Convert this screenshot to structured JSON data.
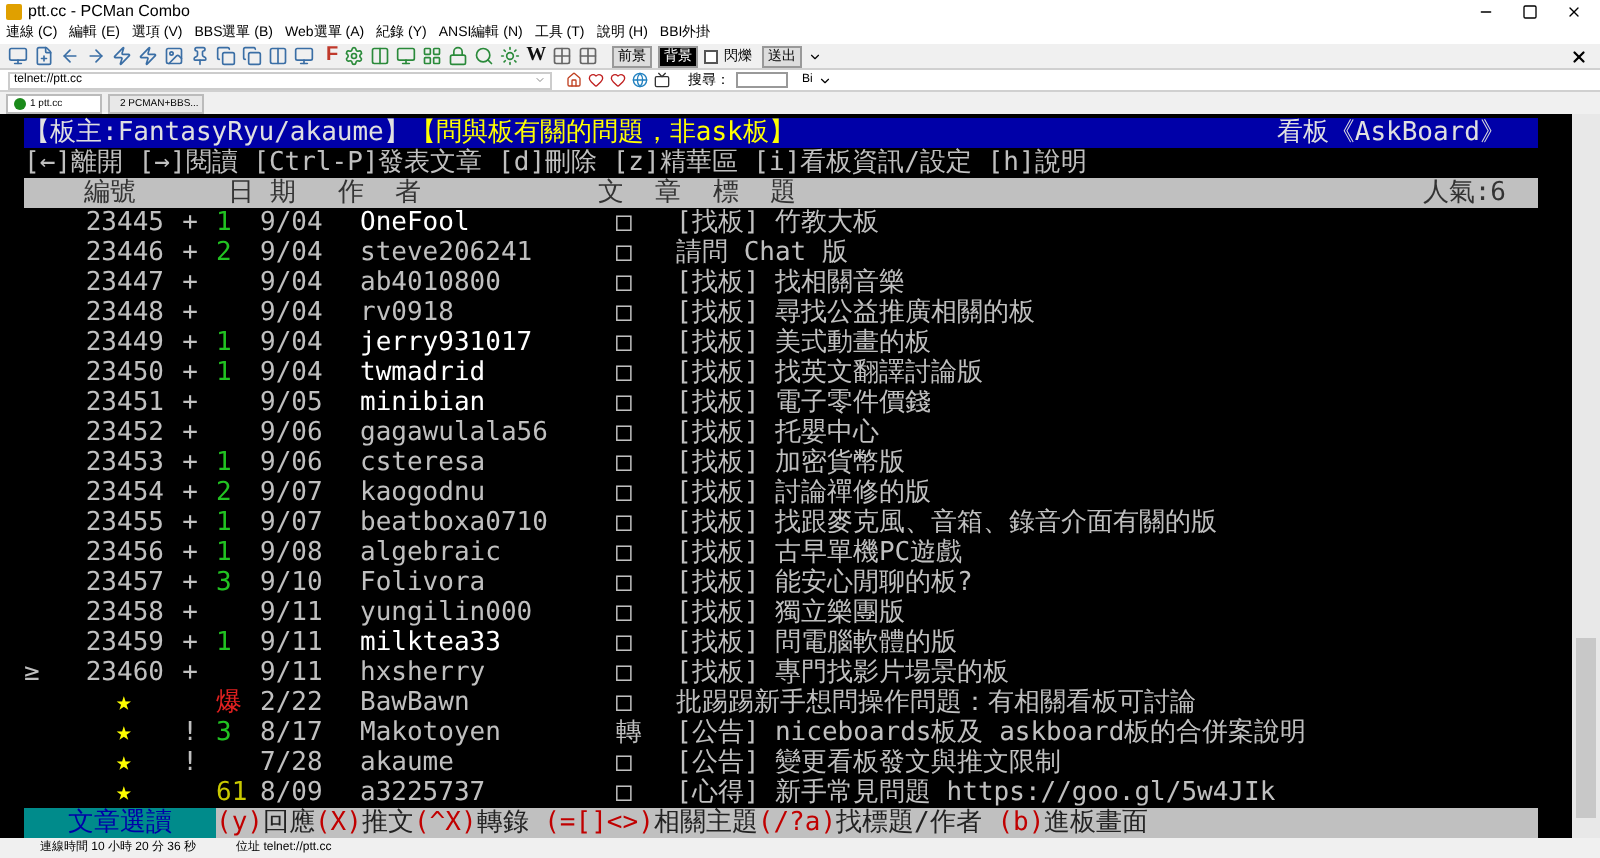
{
  "window": {
    "title": "ptt.cc - PCMan Combo"
  },
  "menu": [
    "連線 (C)",
    "編輯 (E)",
    "選項 (V)",
    "BBS選單 (B)",
    "Web選單 (A)",
    "紀錄 (Y)",
    "ANSI編輯 (N)",
    "工具 (T)",
    "說明 (H)",
    "BBI外掛"
  ],
  "toolbar": {
    "letters": [
      {
        "label": "F",
        "color": "#c0392b"
      },
      {
        "label": "W",
        "color": "#111111"
      }
    ],
    "foreground": "前景",
    "background": "背景",
    "blink": {
      "label": "閃爍",
      "checked": false
    },
    "send": "送出"
  },
  "address": {
    "value": "telnet://ptt.cc"
  },
  "search": {
    "label": "搜尋：",
    "engine": "Bi"
  },
  "tabs": [
    {
      "label": "1 ptt.cc",
      "selected": true
    },
    {
      "label": "2 PCMAN+BBS...",
      "selected": false
    }
  ],
  "terminal": {
    "header": {
      "moderator": "【板主:FantasyRyu/akaume】",
      "topic": "【問與板有關的問題，非ask板】",
      "board": "看板《AskBoard》"
    },
    "keys": "[←]離開 [→]閱讀 [Ctrl-P]發表文章 [d]刪除 [z]精華區 [i]看板資訊/設定 [h]說明",
    "columns": {
      "number": "編號",
      "date": "日 期",
      "author": "作  者",
      "title": "文  章  標  題",
      "popularity": "人氣:6"
    },
    "cursor": "≥",
    "rows": [
      {
        "kind": "article",
        "selected": false,
        "number": "23445",
        "mark": "+",
        "count": "1",
        "color": "#22c322",
        "date": "9/04",
        "author": "OneFool",
        "bright": true,
        "box": "□",
        "title": "[找板] 竹教大板"
      },
      {
        "kind": "article",
        "selected": false,
        "number": "23446",
        "mark": "+",
        "count": "2",
        "color": "#22c322",
        "date": "9/04",
        "author": "steve206241",
        "bright": false,
        "box": "□",
        "title": "請問 Chat 版"
      },
      {
        "kind": "article",
        "selected": false,
        "number": "23447",
        "mark": "+",
        "date": "9/04",
        "author": "ab4010800",
        "bright": false,
        "box": "□",
        "title": "[找板] 找相關音樂"
      },
      {
        "kind": "article",
        "selected": false,
        "number": "23448",
        "mark": "+",
        "date": "9/04",
        "author": "rv0918",
        "bright": false,
        "box": "□",
        "title": "[找板] 尋找公益推廣相關的板"
      },
      {
        "kind": "article",
        "selected": false,
        "number": "23449",
        "mark": "+",
        "count": "1",
        "color": "#22c322",
        "date": "9/04",
        "author": "jerry931017",
        "bright": true,
        "box": "□",
        "title": "[找板] 美式動畫的板"
      },
      {
        "kind": "article",
        "selected": false,
        "number": "23450",
        "mark": "+",
        "count": "1",
        "color": "#22c322",
        "date": "9/04",
        "author": "twmadrid",
        "bright": true,
        "box": "□",
        "title": "[找板] 找英文翻譯討論版"
      },
      {
        "kind": "article",
        "selected": false,
        "number": "23451",
        "mark": "+",
        "date": "9/05",
        "author": "minibian",
        "bright": true,
        "box": "□",
        "title": "[找板] 電子零件價錢"
      },
      {
        "kind": "article",
        "selected": false,
        "number": "23452",
        "mark": "+",
        "date": "9/06",
        "author": "gagawulala56",
        "bright": false,
        "box": "□",
        "title": "[找板] 托嬰中心"
      },
      {
        "kind": "article",
        "selected": false,
        "number": "23453",
        "mark": "+",
        "count": "1",
        "color": "#22c322",
        "date": "9/06",
        "author": "csteresa",
        "bright": false,
        "box": "□",
        "title": "[找板] 加密貨幣版"
      },
      {
        "kind": "article",
        "selected": false,
        "number": "23454",
        "mark": "+",
        "count": "2",
        "color": "#22c322",
        "date": "9/07",
        "author": "kaogodnu",
        "bright": false,
        "box": "□",
        "title": "[找板] 討論禪修的版"
      },
      {
        "kind": "article",
        "selected": false,
        "number": "23455",
        "mark": "+",
        "count": "1",
        "color": "#22c322",
        "date": "9/07",
        "author": "beatboxa0710",
        "bright": false,
        "box": "□",
        "title": "[找板] 找跟麥克風、音箱、錄音介面有關的版"
      },
      {
        "kind": "article",
        "selected": false,
        "number": "23456",
        "mark": "+",
        "count": "1",
        "color": "#22c322",
        "date": "9/08",
        "author": "algebraic",
        "bright": false,
        "box": "□",
        "title": "[找板] 古早單機PC遊戲"
      },
      {
        "kind": "article",
        "selected": false,
        "number": "23457",
        "mark": "+",
        "count": "3",
        "color": "#22c322",
        "date": "9/10",
        "author": "Folivora",
        "bright": false,
        "box": "□",
        "title": "[找板] 能安心閒聊的板?"
      },
      {
        "kind": "article",
        "selected": false,
        "number": "23458",
        "mark": "+",
        "date": "9/11",
        "author": "yungilin000",
        "bright": false,
        "box": "□",
        "title": "[找板] 獨立樂團版"
      },
      {
        "kind": "article",
        "selected": false,
        "number": "23459",
        "mark": "+",
        "count": "1",
        "color": "#22c322",
        "date": "9/11",
        "author": "milktea33",
        "bright": true,
        "box": "□",
        "title": "[找板] 問電腦軟體的版"
      },
      {
        "kind": "article",
        "selected": true,
        "number": "23460",
        "mark": "+",
        "date": "9/11",
        "author": "hxsherry",
        "bright": false,
        "box": "□",
        "title": "[找板] 專門找影片場景的板"
      },
      {
        "kind": "pinned",
        "selected": false,
        "number": "★",
        "count": "爆",
        "color": "#e02020",
        "date": "2/22",
        "author": "BawBawn",
        "bright": false,
        "box": "□",
        "title": "批踢踢新手想問操作問題：有相關看板可討論"
      },
      {
        "kind": "pinned",
        "selected": false,
        "number": "★",
        "mark": "!",
        "count": "3",
        "color": "#22c322",
        "date": "8/17",
        "author": "Makotoyen",
        "bright": false,
        "box": "轉",
        "title": "[公告] niceboards板及 askboard板的合併案說明"
      },
      {
        "kind": "pinned",
        "selected": false,
        "number": "★",
        "mark": "!",
        "date": "7/28",
        "author": "akaume",
        "bright": false,
        "box": "□",
        "title": "[公告] 變更看板發文與推文限制"
      },
      {
        "kind": "pinned",
        "selected": false,
        "number": "★",
        "count": "61",
        "color": "#c8c800",
        "date": "8/09",
        "author": "a3225737",
        "bright": false,
        "box": "□",
        "title": "[心得] 新手常見問題 https://goo.gl/5w4JIk"
      }
    ],
    "footer": {
      "mode": "文章選讀",
      "commands": [
        {
          "key": "(y)",
          "label": "回應"
        },
        {
          "key": "(X)",
          "label": "推文"
        },
        {
          "key": "(^X)",
          "label": "轉錄"
        },
        {
          "key": " (=[]<>)",
          "label": "相關主題"
        },
        {
          "key": "(/?a)",
          "label": "找標題/作者"
        },
        {
          "key": " (b)",
          "label": "進板畫面"
        }
      ]
    }
  },
  "status_bar": {
    "uptime": "連線時間 10 小時 20 分 36 秒",
    "address": "位址 telnet://ptt.cc"
  }
}
